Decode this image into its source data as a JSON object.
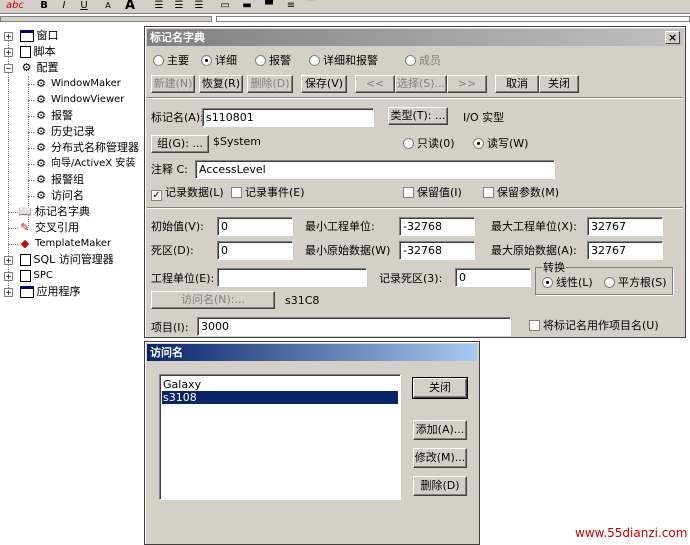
{
  "toolbar": {
    "buttons": [
      "abc",
      "B",
      "I",
      "U",
      "A",
      "A"
    ]
  },
  "tree": {
    "items": [
      {
        "label": "窗口",
        "icon": "window-icon"
      },
      {
        "label": "脚本",
        "icon": "script-icon"
      },
      {
        "label": "配置",
        "icon": "config-icon"
      },
      {
        "label": "WindowMaker",
        "icon": "gears-icon"
      },
      {
        "label": "WindowViewer",
        "icon": "gears-icon"
      },
      {
        "label": "报警",
        "icon": "gears-icon"
      },
      {
        "label": "历史记录",
        "icon": "gears-icon"
      },
      {
        "label": "分布式名称管理器",
        "icon": "gears-icon"
      },
      {
        "label": "向导/ActiveX 安装",
        "icon": "gears-icon"
      },
      {
        "label": "报警组",
        "icon": "gears-icon"
      },
      {
        "label": "访问名",
        "icon": "gears-icon"
      },
      {
        "label": "标记名字典",
        "icon": "dictionary-icon"
      },
      {
        "label": "交叉引用",
        "icon": "cross-reference-icon"
      },
      {
        "label": "TemplateMaker",
        "icon": "template-icon"
      },
      {
        "label": "SQL 访问管理器",
        "icon": "sql-icon"
      },
      {
        "label": "SPC",
        "icon": "spc-icon"
      },
      {
        "label": "应用程序",
        "icon": "application-icon"
      }
    ]
  },
  "tagdict": {
    "title": "标记名字典",
    "close": "×",
    "modes": [
      {
        "label": "主要",
        "checked": false,
        "disabled": false
      },
      {
        "label": "详细",
        "checked": true,
        "disabled": false
      },
      {
        "label": "报警",
        "checked": false,
        "disabled": false
      },
      {
        "label": "详细和报警",
        "checked": false,
        "disabled": false
      },
      {
        "label": "成员",
        "checked": false,
        "disabled": true
      }
    ],
    "buttons": {
      "new": "新建(N)",
      "restore": "恢复(R)",
      "delete": "删除(D)",
      "save": "保存(V)",
      "prev": "<<",
      "select": "选择(S)...",
      "next": ">>",
      "cancel": "取消",
      "close": "关闭"
    },
    "tagname_label": "标记名(A):",
    "tagname_value": "s110801",
    "type_button": "类型(T): ...",
    "type_value": "I/O 实型",
    "group_button": "组(G): ...",
    "group_value": "$System",
    "readonly": "只读(0)",
    "readwrite": "读写(W)",
    "comment_label": "注释 C:",
    "comment_value": "AccessLevel",
    "log_data": "记录数据(L)",
    "log_events": "记录事件(E)",
    "retentive_value": "保留值(I)",
    "retentive_params": "保留参数(M)",
    "initial_label": "初始值(V):",
    "initial_value": "0",
    "min_eu_label": "最小工程单位:",
    "min_eu_value": "-32768",
    "max_eu_label": "最大工程单位(X):",
    "max_eu_value": "32767",
    "deadband_label": "死区(D):",
    "deadband_value": "0",
    "min_raw_label": "最小原始数据(W)",
    "min_raw_value": "-32768",
    "max_raw_label": "最大原始数据(A):",
    "max_raw_value": "32767",
    "eng_units_label": "工程单位(E):",
    "eng_units_value": "",
    "log_deadband_label": "记录死区(3):",
    "log_deadband_value": "0",
    "conversion_title": "转换",
    "linear": "线性(L)",
    "sqrt": "平方根(S)",
    "access_name_button": "访问名(N):...",
    "access_name_value": "s31C8",
    "item_label": "项目(I):",
    "item_value": "3000",
    "use_tagname": "将标记名用作项目名(U)"
  },
  "accessdlg": {
    "title": "访问名",
    "items": [
      {
        "label": "Galaxy",
        "selected": false
      },
      {
        "label": "s3108",
        "selected": true
      }
    ],
    "close": "关闭",
    "add": "添加(A)...",
    "modify": "修改(M)...",
    "delete": "删除(D)"
  },
  "watermark": "www.55dianzi.com",
  "colors": {
    "dialog_bg": "#d4d0c8",
    "title_active_start": "#0a246a",
    "title_active_end": "#a6caf0",
    "title_inactive_start": "#808080",
    "title_inactive_end": "#c0c0c0",
    "selection": "#0a246a",
    "watermark": "#cc0000"
  }
}
